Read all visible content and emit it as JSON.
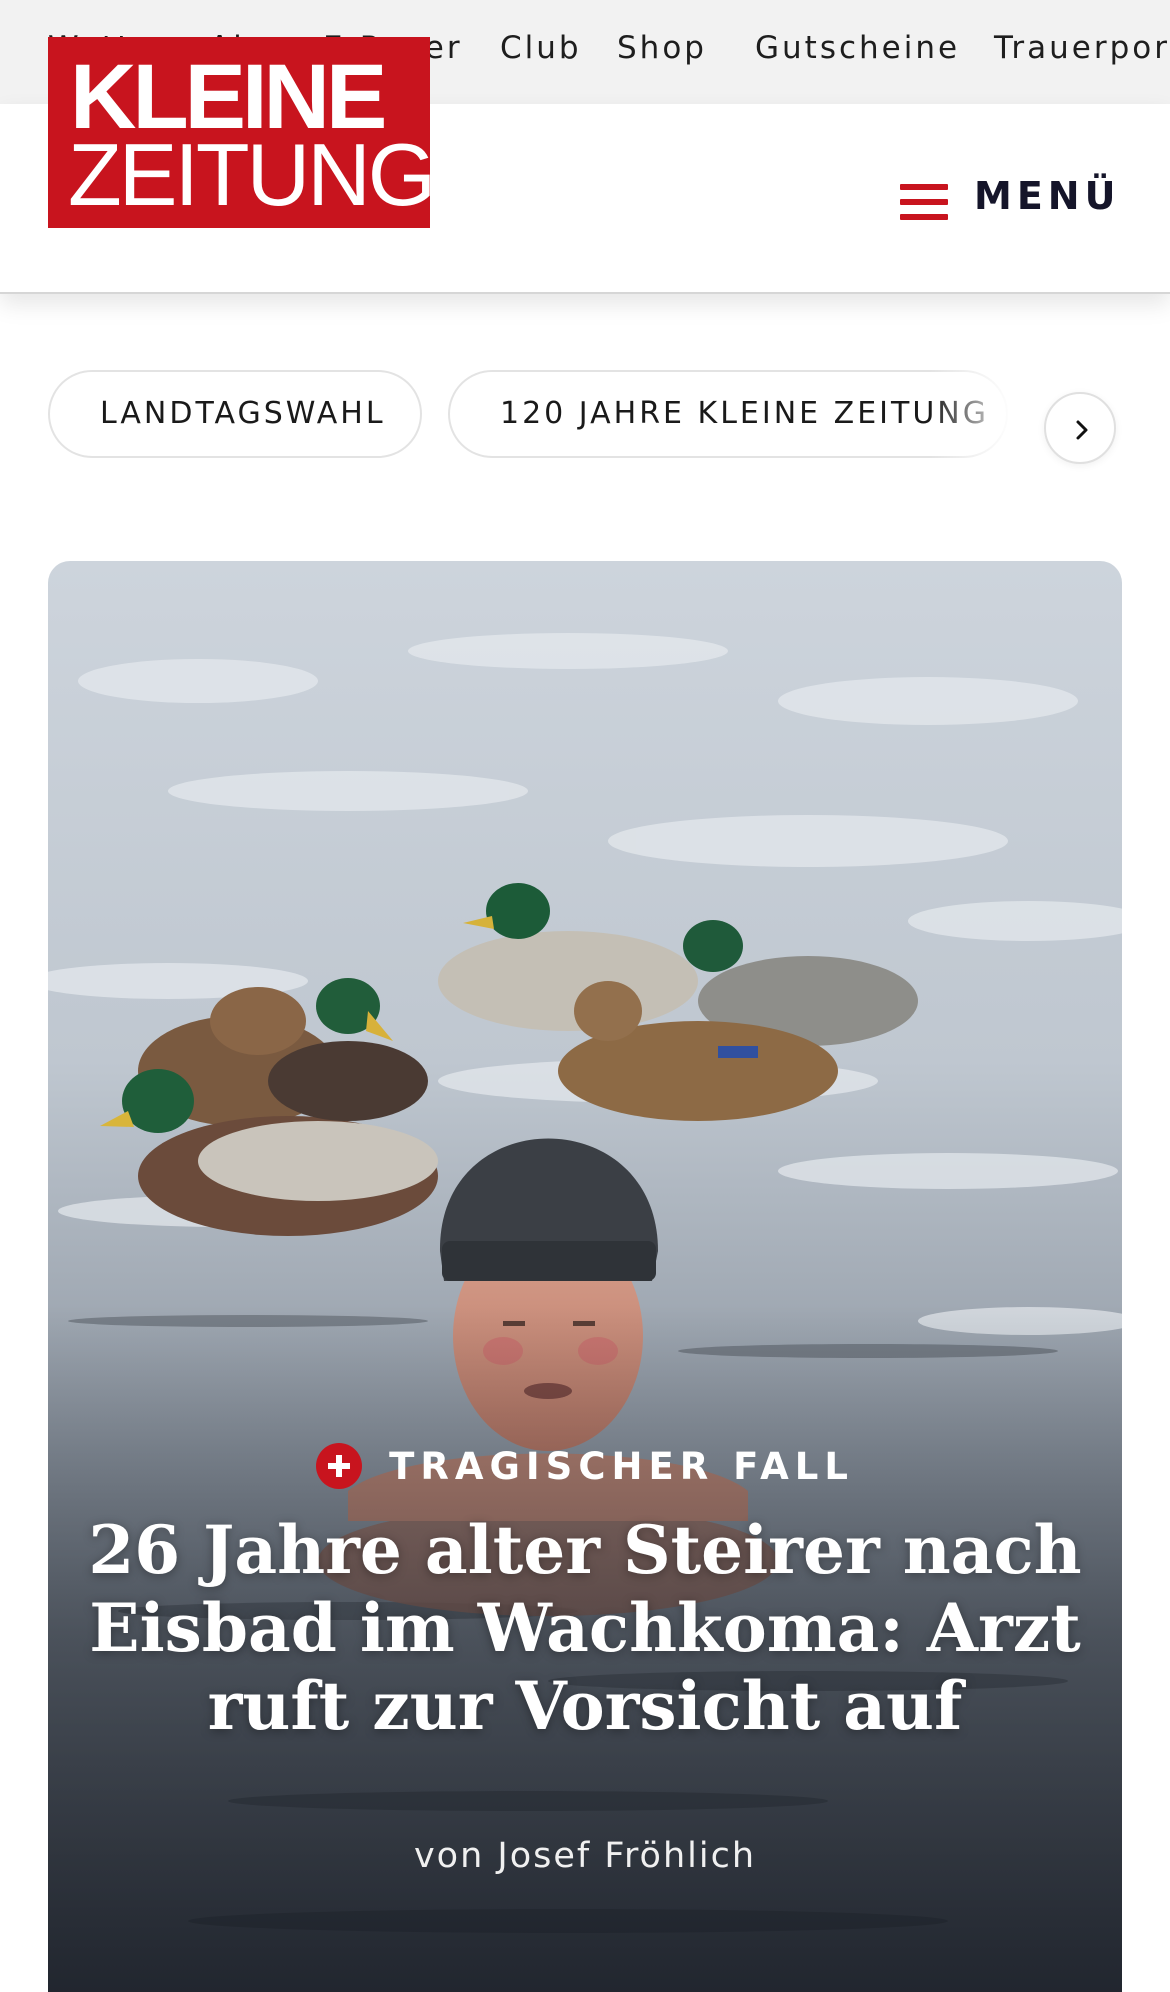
{
  "top_nav": {
    "items": [
      {
        "label": "Wetter"
      },
      {
        "label": "Abo"
      },
      {
        "label": "E-Paper"
      },
      {
        "label": "Club"
      },
      {
        "label": "Shop"
      },
      {
        "label": "Gutscheine"
      },
      {
        "label": "Trauerportal"
      }
    ]
  },
  "header": {
    "logo_line1": "KLEINE",
    "logo_line2": "ZEITUNG",
    "menu_label": "MENÜ"
  },
  "tags": [
    {
      "label": "LANDTAGSWAHL"
    },
    {
      "label": "120 JAHRE KLEINE ZEITUNG"
    }
  ],
  "hero": {
    "kicker": "TRAGISCHER FALL",
    "headline": "26 Jahre alter Steirer nach Eisbad im Wachkoma: Arzt ruft zur Vorsicht auf",
    "byline": "von Josef Fröhlich"
  },
  "colors": {
    "brand_red": "#c8141e",
    "nav_bg": "#f2f2f2",
    "menu_text": "#15152a"
  },
  "icons": [
    "hamburger-icon",
    "chevron-right-icon",
    "plus-icon"
  ]
}
